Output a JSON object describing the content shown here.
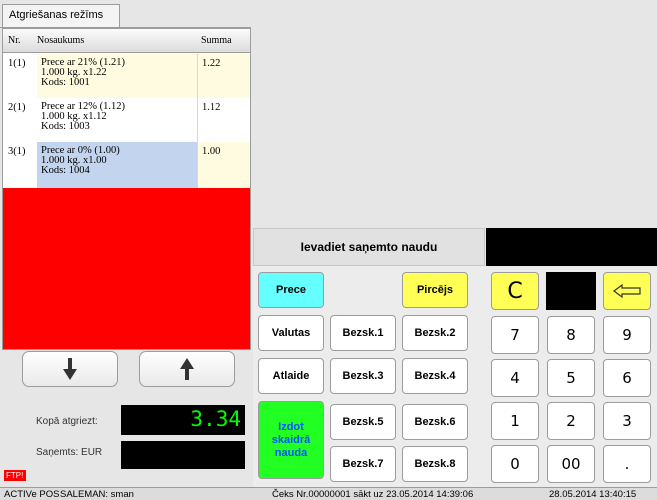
{
  "tab": {
    "label": "Atgriešanas režīms"
  },
  "table": {
    "headers": {
      "nr": "Nr.",
      "name": "Nosaukums",
      "sum": "Summa"
    },
    "rows": [
      {
        "nr": "1(1)",
        "line1": "Prece ar 21% (1.21)",
        "line2": "1.000 kg. x1.22",
        "line3": "Kods: 1001",
        "sum": "1.22",
        "bg": "#fffbe0"
      },
      {
        "nr": "2(1)",
        "line1": "Prece ar 12% (1.12)",
        "line2": "1.000 kg. x1.12",
        "line3": "Kods: 1003",
        "sum": "1.12",
        "bg": "#ffffff"
      },
      {
        "nr": "3(1)",
        "line1": "Prece ar 0% (1.00)",
        "line2": "1.000 kg. x1.00",
        "line3": "Kods: 1004",
        "sum": "1.00",
        "bg": "#c3d4ee",
        "sum_bg": "#fffbe0"
      }
    ]
  },
  "totals": {
    "kopa_label": "Kopā atgriezt:",
    "kopa_value": "3.34",
    "sanemts_label": "Saņemts: EUR",
    "ftp": "FTP!"
  },
  "prompt": "Ievadiet saņemto naudu",
  "functions": {
    "prece": "Prece",
    "pircejs": "Pircējs",
    "valutas": "Valutas",
    "bezsk1": "Bezsk.1",
    "bezsk2": "Bezsk.2",
    "atlaide": "Atlaide",
    "bezsk3": "Bezsk.3",
    "bezsk4": "Bezsk.4",
    "izdot": "Izdot skaidrā nauda",
    "bezsk5": "Bezsk.5",
    "bezsk6": "Bezsk.6",
    "bezsk7": "Bezsk.7",
    "bezsk8": "Bezsk.8"
  },
  "keypad": {
    "clear": "C",
    "k7": "7",
    "k8": "8",
    "k9": "9",
    "k4": "4",
    "k5": "5",
    "k6": "6",
    "k1": "1",
    "k2": "2",
    "k3": "3",
    "k0": "0",
    "k00": "00",
    "kdot": "."
  },
  "colors": {
    "accent_cyan": "#66ffff",
    "accent_yellow": "#ffff55",
    "accent_green": "#22ff22",
    "total_text": "#00ff00",
    "red_area": "#ff0000"
  },
  "status": {
    "app": "ACTIVe POS",
    "salesman": "SALEMAN: sman",
    "receipt": "Čeks Nr.00000001 sākt uz 23.05.2014 14:39:06",
    "clock": "28.05.2014 13:40:15"
  }
}
